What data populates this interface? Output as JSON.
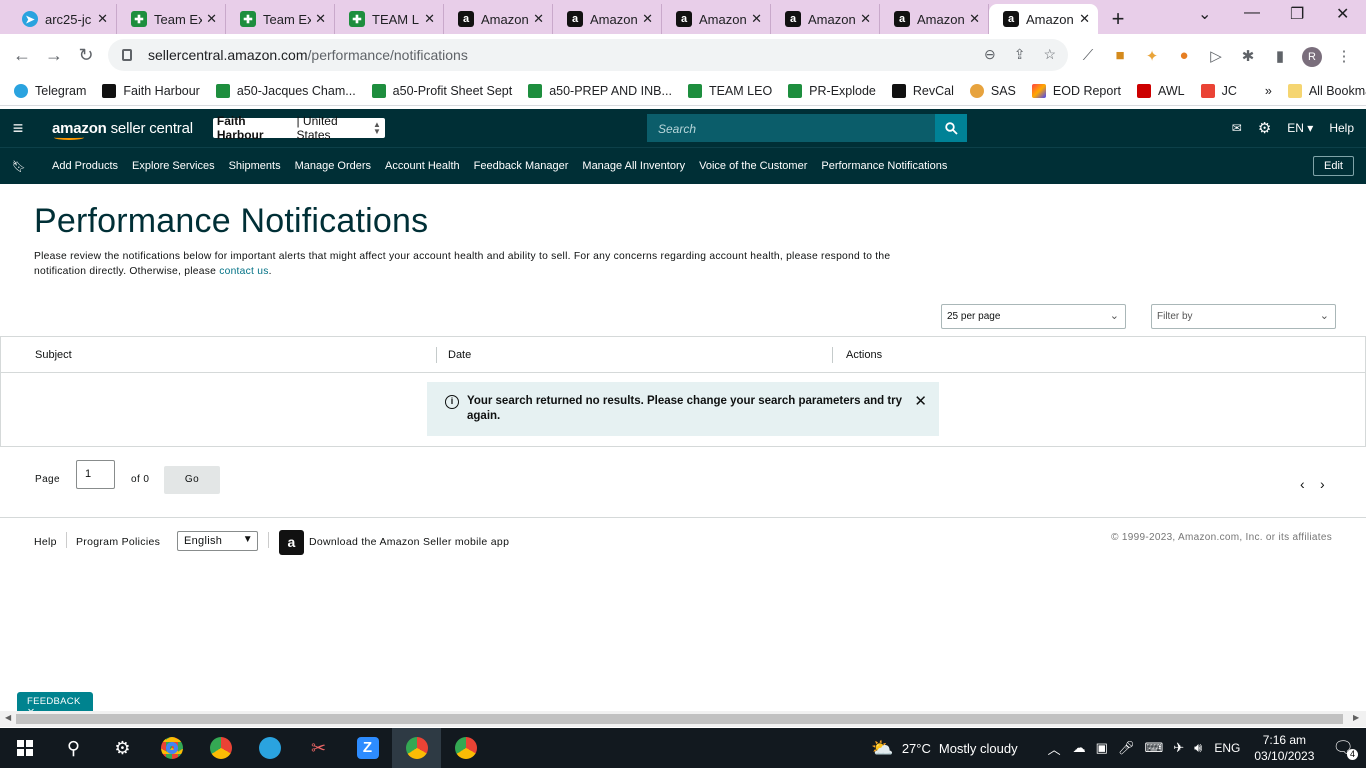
{
  "browser": {
    "tabs": [
      {
        "title": "arc25-jc",
        "icon": "telegram-icon"
      },
      {
        "title": "Team Ex",
        "icon": "sheets-icon"
      },
      {
        "title": "Team Ex",
        "icon": "sheets-icon"
      },
      {
        "title": "TEAM L",
        "icon": "sheets-icon"
      },
      {
        "title": "Amazon",
        "icon": "amazon-icon"
      },
      {
        "title": "Amazon",
        "icon": "amazon-icon"
      },
      {
        "title": "Amazon",
        "icon": "amazon-icon"
      },
      {
        "title": "Amazon",
        "icon": "amazon-icon"
      },
      {
        "title": "Amazon",
        "icon": "amazon-icon"
      },
      {
        "title": "Amazon",
        "icon": "amazon-icon"
      }
    ],
    "url_host": "sellercentral.amazon.com",
    "url_path": "/performance/notifications",
    "profile_initial": "R",
    "bookmarks": [
      "Telegram",
      "Faith Harbour",
      "a50-Jacques Cham...",
      "a50-Profit Sheet Sept",
      "a50-PREP AND INB...",
      "TEAM LEO",
      "PR-Explode",
      "RevCal",
      "SAS",
      "EOD Report",
      "AWL",
      "JC"
    ],
    "all_bookmarks": "All Bookmarks"
  },
  "header": {
    "logo_bold": "amazon",
    "logo_rest": " seller central",
    "account_store": "Faith Harbour",
    "account_region": "| United States",
    "search_placeholder": "Search",
    "lang": "EN",
    "help": "Help"
  },
  "nav": {
    "items": [
      "Add Products",
      "Explore Services",
      "Shipments",
      "Manage Orders",
      "Account Health",
      "Feedback Manager",
      "Manage All Inventory",
      "Voice of the Customer",
      "Performance Notifications"
    ],
    "edit": "Edit"
  },
  "page": {
    "title": "Performance Notifications",
    "desc_text": "Please review the notifications below for important alerts that might affect your account health and ability to sell. For any concerns regarding account health, please respond to the notification directly. Otherwise, please ",
    "desc_link": "contact us",
    "desc_end": ".",
    "per_page": "25 per page",
    "filter": "Filter by"
  },
  "table": {
    "col_subject": "Subject",
    "col_date": "Date",
    "col_actions": "Actions",
    "empty_message": "Your search returned no results. Please change your search parameters and try again."
  },
  "pager": {
    "label": "Page",
    "page_value": "1",
    "of": "of 0",
    "go": "Go"
  },
  "footer": {
    "help": "Help",
    "policies": "Program Policies",
    "language": "English",
    "app_text": "Download the Amazon Seller mobile app",
    "copyright": "© 1999-2023, Amazon.com, Inc. or its affiliates"
  },
  "feedback": "FEEDBACK",
  "taskbar": {
    "temp": "27°C",
    "weather": "Mostly cloudy",
    "lang": "ENG",
    "time": "7:16 am",
    "date": "03/10/2023",
    "notif_count": "4"
  }
}
